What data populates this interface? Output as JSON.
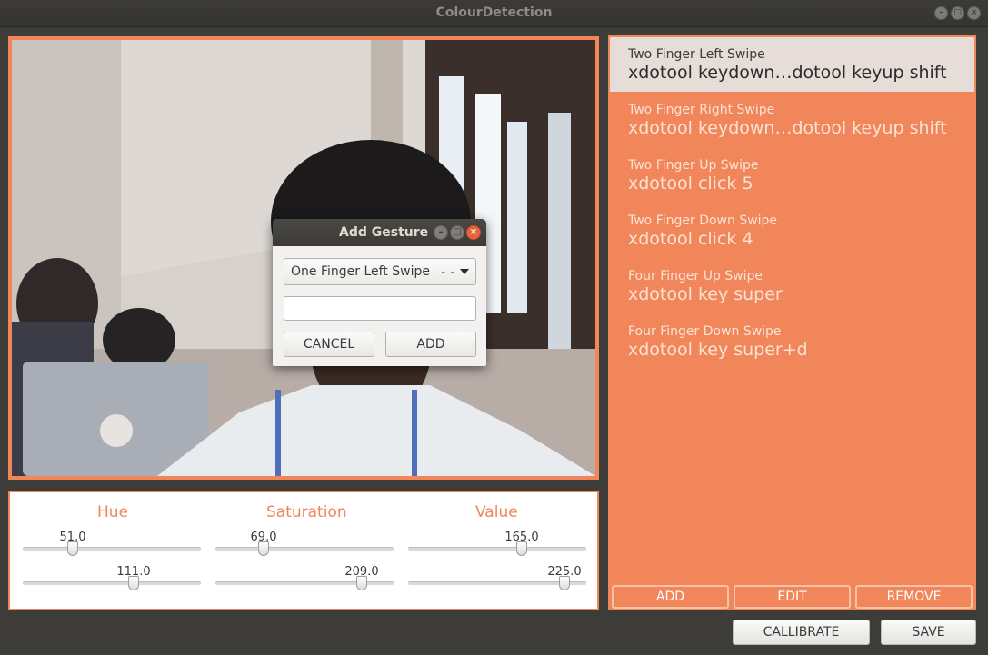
{
  "window": {
    "title": "ColourDetection"
  },
  "sliders": {
    "columns": [
      {
        "title": "Hue",
        "min_value": "51.0",
        "max_value": "111.0",
        "min_fraction": 0.28,
        "max_fraction": 0.62
      },
      {
        "title": "Saturation",
        "min_value": "69.0",
        "max_value": "209.0",
        "min_fraction": 0.27,
        "max_fraction": 0.82
      },
      {
        "title": "Value",
        "min_value": "165.0",
        "max_value": "225.0",
        "min_fraction": 0.64,
        "max_fraction": 0.88
      }
    ]
  },
  "gestures": {
    "items": [
      {
        "name": "Two Finger Left Swipe",
        "command": "xdotool keydown…dotool keyup shift",
        "selected": true
      },
      {
        "name": "Two Finger Right Swipe",
        "command": "xdotool keydown…dotool keyup shift",
        "selected": false
      },
      {
        "name": "Two Finger Up Swipe",
        "command": "xdotool click 5",
        "selected": false
      },
      {
        "name": "Two Finger Down Swipe",
        "command": "xdotool click 4",
        "selected": false
      },
      {
        "name": "Four Finger Up Swipe",
        "command": "xdotool key super",
        "selected": false
      },
      {
        "name": "Four Finger Down Swipe",
        "command": "xdotool key super+d",
        "selected": false
      }
    ],
    "add_label": "ADD",
    "edit_label": "EDIT",
    "remove_label": "REMOVE"
  },
  "footer": {
    "calibrate_label": "CALLIBRATE",
    "save_label": "SAVE"
  },
  "dialog": {
    "title": "Add Gesture",
    "selected_gesture": "One Finger Left Swipe",
    "select_indicator": "- -",
    "command_value": "",
    "cancel_label": "CANCEL",
    "add_label": "ADD"
  },
  "colors": {
    "accent": "#f0865a",
    "selected_item": "#e6dcd8",
    "window_bg": "#3d3c39"
  }
}
